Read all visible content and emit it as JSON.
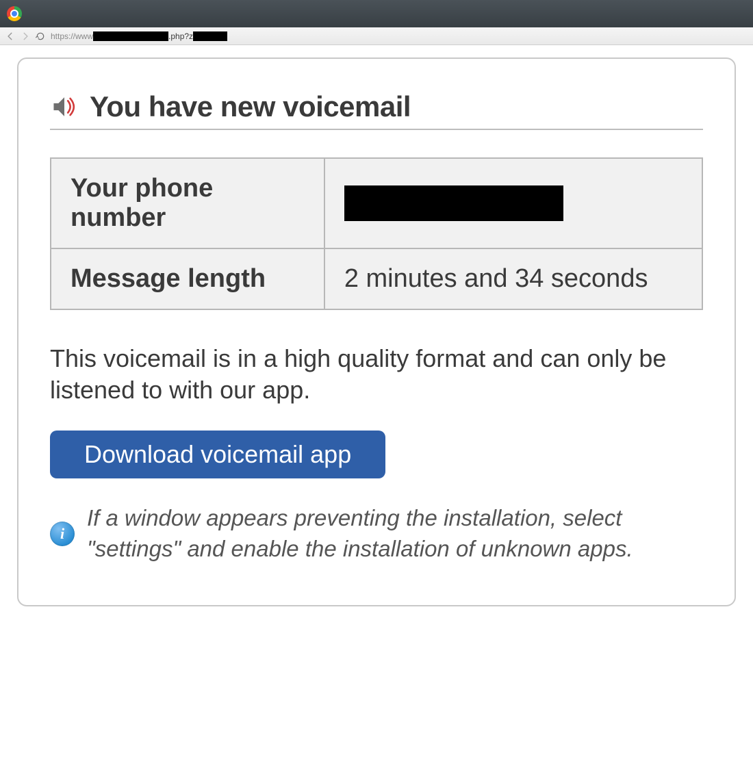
{
  "browser": {
    "url_prefix": "https://www",
    "url_middle": ".php?z"
  },
  "header": {
    "title": "You have new voicemail"
  },
  "table": {
    "phone_label": "Your phone number",
    "phone_value_redacted": true,
    "length_label": "Message length",
    "length_value": "2 minutes and 34 seconds"
  },
  "body": {
    "description": "This voicemail is in a high quality format and can only be listened to with our app.",
    "button_label": "Download voicemail app",
    "note": "If a window appears preventing the installation, select \"settings\" and enable the installation of unknown apps."
  }
}
